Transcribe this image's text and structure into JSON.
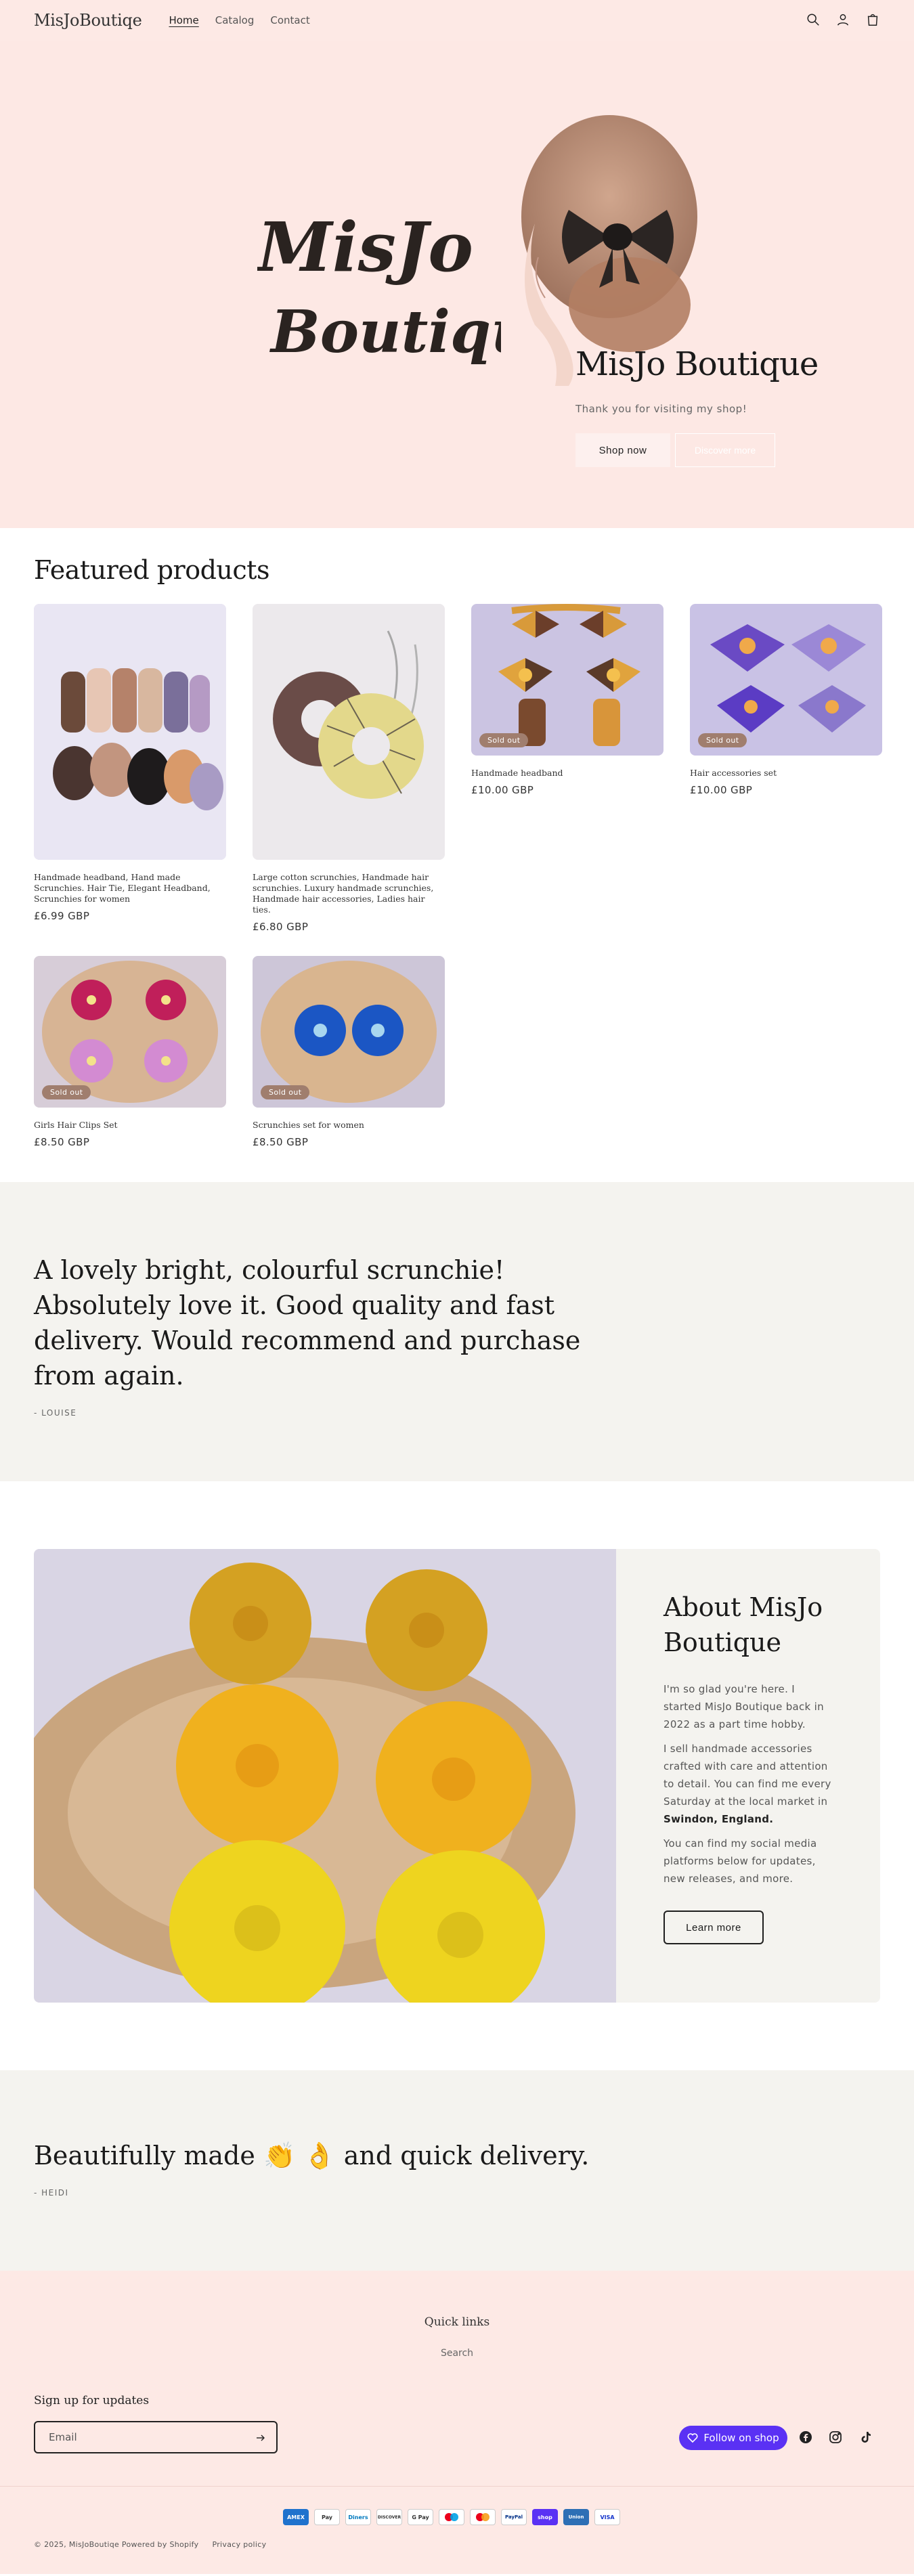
{
  "header": {
    "logo": "MisJoBoutiqe",
    "nav": [
      "Home",
      "Catalog",
      "Contact"
    ],
    "icons": [
      "search-icon",
      "account-icon",
      "cart-icon"
    ]
  },
  "hero": {
    "script_line1": "MisJo",
    "script_line2": "Boutique",
    "title": "MisJo Boutique",
    "subtitle": "Thank you for visiting my shop!",
    "primary_button": "Shop now",
    "secondary_button": "Discover more"
  },
  "featured": {
    "title": "Featured products",
    "products": [
      {
        "title": "Handmade headband, Hand made Scrunchies. Hair Tie, Elegant Headband, Scrunchies for women",
        "price": "£6.99 GBP",
        "sold_out": false
      },
      {
        "title": "Large cotton scrunchies, Handmade hair scrunchies. Luxury handmade scrunchies, Handmade hair accessories, Ladies hair ties.",
        "price": "£6.80 GBP",
        "sold_out": false
      },
      {
        "title": "Handmade headband",
        "price": "£10.00 GBP",
        "sold_out": true
      },
      {
        "title": "Hair accessories set",
        "price": "£10.00 GBP",
        "sold_out": true
      },
      {
        "title": "Girls Hair Clips Set",
        "price": "£8.50 GBP",
        "sold_out": true
      },
      {
        "title": "Scrunchies set for women",
        "price": "£8.50 GBP",
        "sold_out": true
      }
    ],
    "badge_label": "Sold out"
  },
  "testimonial1": {
    "quote": "A lovely bright, colourful scrunchie! Absolutely love it. Good quality and fast delivery. Would recommend and purchase from again.",
    "author": "- LOUISE"
  },
  "about": {
    "title": "About MisJo Boutique",
    "p1": "I'm so glad you're here. I started MisJo Boutique back in 2022 as a part time hobby.",
    "p2a": "I sell handmade accessories crafted with care and attention to detail. You can find me every Saturday at the local market in ",
    "p2b": "Swindon, England.",
    "p3": "You can find my social media platforms below for updates, new releases, and more.",
    "button": "Learn more"
  },
  "testimonial2": {
    "quote": "Beautifully made 👏 👌 and quick delivery.",
    "author": "- HEIDI"
  },
  "footer": {
    "quick_links_title": "Quick links",
    "quick_link": "Search",
    "signup_title": "Sign up for updates",
    "email_placeholder": "Email",
    "follow_label": "Follow on shop",
    "socials": [
      "facebook-icon",
      "instagram-icon",
      "tiktok-icon"
    ],
    "payments": [
      "AMEX",
      "Pay",
      "Diners",
      "DISCOVER",
      "G Pay",
      "Maestro",
      "MC",
      "PayPal",
      "shop",
      "Union",
      "VISA"
    ],
    "copyright": "© 2025, MisJoBoutiqe Powered by Shopify",
    "policy": "Privacy policy"
  },
  "colors": {
    "header_bg": "#fde9e5",
    "testimonial_bg": "#f4f3ef",
    "badge": "#a07e6e",
    "shop_purple": "#5a31f4"
  }
}
